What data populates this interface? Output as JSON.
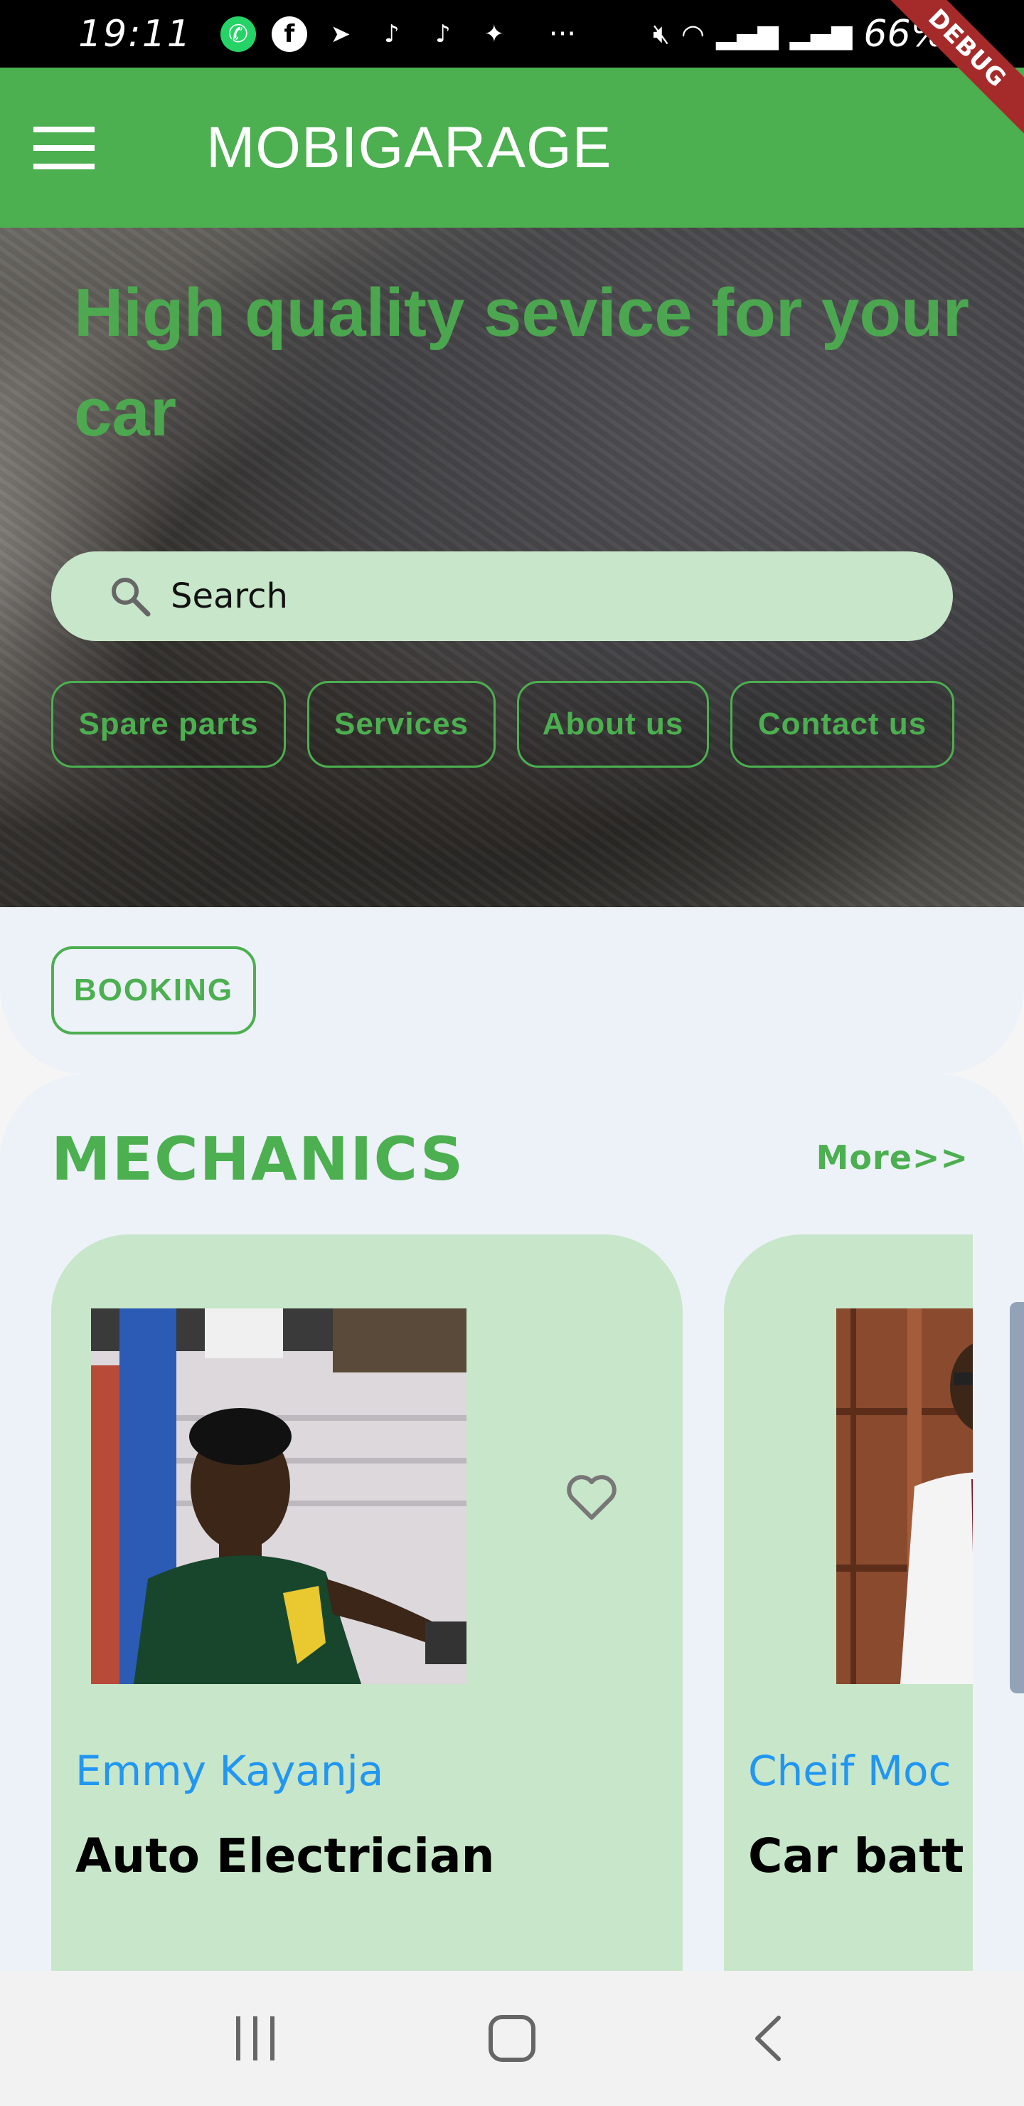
{
  "status_bar": {
    "time": "19:11",
    "apps": [
      "whatsapp-icon",
      "facebook-icon",
      "telegram-icon",
      "tiktok-icon",
      "tiktok-icon",
      "twitter-icon"
    ],
    "more": "···",
    "battery": "66%",
    "debug_label": "DEBUG"
  },
  "app_bar": {
    "title": "MOBIGARAGE",
    "menu_icon": "hamburger-menu-icon",
    "color": "#4caf50"
  },
  "hero": {
    "title": "High quality sevice for your car",
    "search_placeholder": "Search",
    "chips": [
      "Spare parts",
      "Services",
      "About us",
      "Contact us"
    ]
  },
  "booking": {
    "label": "BOOKING"
  },
  "mechanics": {
    "title": "MECHANICS",
    "more_label": "More>>",
    "cards": [
      {
        "name": "Emmy Kayanja",
        "role": "Auto Electrician"
      },
      {
        "name": "Cheif Moc",
        "role": "Car batt"
      }
    ]
  },
  "colors": {
    "accent": "#4caf50",
    "card_bg": "#c8e6c9",
    "name_blue": "#2196f3",
    "section_bg": "#edf2f9"
  }
}
